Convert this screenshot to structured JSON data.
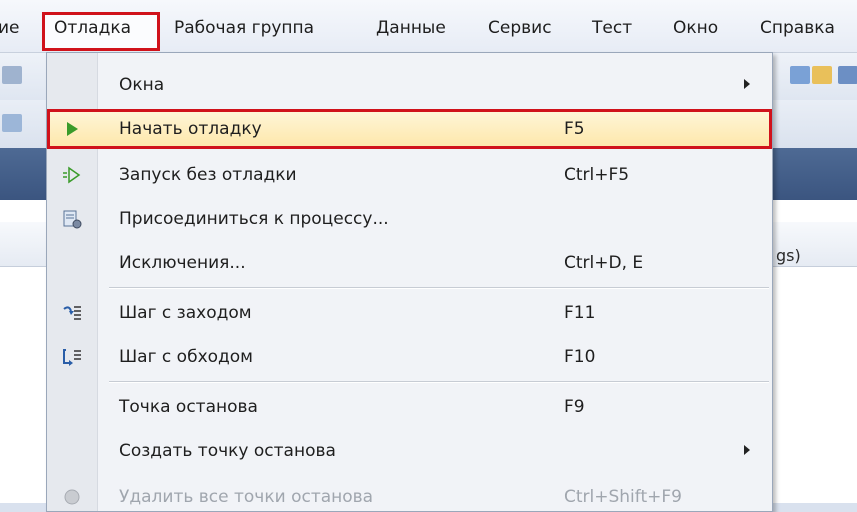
{
  "menubar": {
    "items": [
      "ие",
      "Отладка",
      "Рабочая группа",
      "Данные",
      "Сервис",
      "Тест",
      "Окно",
      "Справка"
    ],
    "active": "Отладка"
  },
  "background": {
    "panel_text": "gs)"
  },
  "debug_menu": {
    "items": [
      {
        "label": "Окна",
        "shortcut": "",
        "icon": "none",
        "submenu": true
      },
      {
        "label": "Начать отладку",
        "shortcut": "F5",
        "icon": "play-icon",
        "highlighted": true
      },
      {
        "label": "Запуск без отладки",
        "shortcut": "Ctrl+F5",
        "icon": "play-outline-icon"
      },
      {
        "label": "Присоединиться к процессу...",
        "shortcut": "",
        "icon": "attach-process-icon"
      },
      {
        "label": "Исключения...",
        "shortcut": "Ctrl+D, E",
        "icon": "none"
      },
      {
        "label": "Шаг с заходом",
        "shortcut": "F11",
        "icon": "step-into-icon"
      },
      {
        "label": "Шаг с обходом",
        "shortcut": "F10",
        "icon": "step-over-icon"
      },
      {
        "label": "Точка останова",
        "shortcut": "F9",
        "icon": "none"
      },
      {
        "label": "Создать точку останова",
        "shortcut": "",
        "icon": "none",
        "submenu": true
      },
      {
        "label": "Удалить все точки останова",
        "shortcut": "Ctrl+Shift+F9",
        "icon": "delete-breakpoints-icon",
        "disabled": true
      }
    ]
  },
  "colors": {
    "highlight_border": "#d0121b",
    "highlight_fill": "#fde7a8",
    "play_green": "#3a9b2a"
  }
}
